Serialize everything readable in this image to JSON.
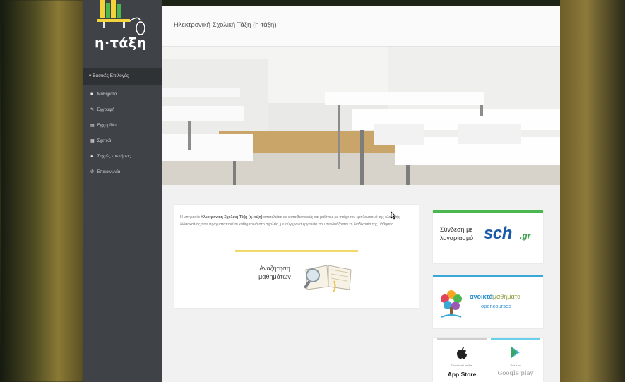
{
  "app": {
    "logo_text": "η·τάξη",
    "header_title": "Ηλεκτρονική Σχολική Τάξη (η-τάξη)"
  },
  "sidebar": {
    "section": "Βασικές Επιλογές",
    "items": [
      {
        "label": "Μαθήματα",
        "icon": "book-icon"
      },
      {
        "label": "Εγγραφή",
        "icon": "edit-icon"
      },
      {
        "label": "Εγχειρίδιο",
        "icon": "document-icon"
      },
      {
        "label": "Σχετικά",
        "icon": "calendar-icon"
      },
      {
        "label": "Συχνές ερωτήσεις",
        "icon": "question-icon"
      },
      {
        "label": "Επικοινωνία",
        "icon": "phone-icon"
      }
    ]
  },
  "intro": {
    "lead": "Η υπηρεσία",
    "bold": "Ηλεκτρονική Σχολική Τάξη (η-τάξη)",
    "rest": "αποτελείται σε εκπαιδευτικούς και μαθητές με στόχο τον εμπλουτισμό της κλασικής διδασκαλίας που πραγματοποιείται καθημερινά στο σχολείο, με σύγχρονα εργαλεία που συνδυάζονται τη διαδικασία της μάθησης.",
    "search_label": "Αναζήτηση μαθημάτων"
  },
  "cards": {
    "sch_label": "Σύνδεση με λογαριασμό",
    "sch_logo": "sch",
    "sch_logo_suffix": ".gr",
    "oc_title_a": "ανοικτά",
    "oc_title_b": "μαθήματα",
    "oc_subtitle": "opencourses",
    "appstore_sub": "Download on the",
    "appstore_name": "App Store",
    "gplay_sub": "Get it on",
    "gplay_name": "Google play"
  },
  "colors": {
    "sidebar": "#3f4347",
    "sch_green": "#4bb84f",
    "oc_blue": "#3ba7d8",
    "yellow_rule": "#f0d86a"
  }
}
